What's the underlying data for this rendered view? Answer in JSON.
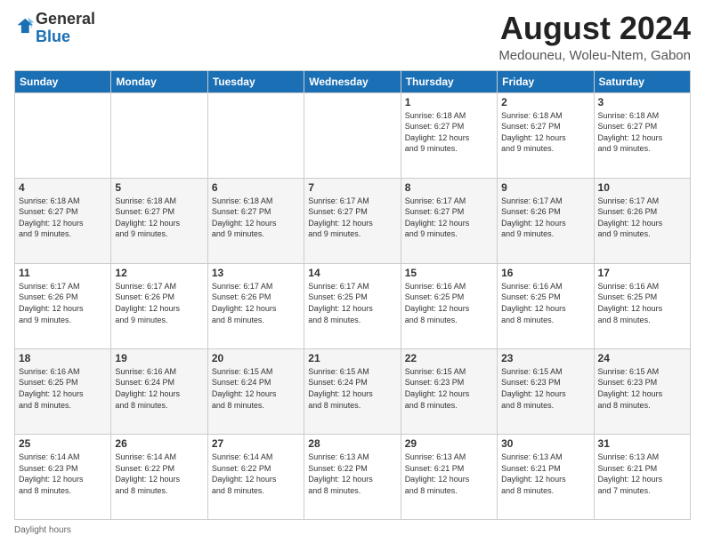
{
  "logo": {
    "general": "General",
    "blue": "Blue"
  },
  "title": "August 2024",
  "subtitle": "Medouneu, Woleu-Ntem, Gabon",
  "days_of_week": [
    "Sunday",
    "Monday",
    "Tuesday",
    "Wednesday",
    "Thursday",
    "Friday",
    "Saturday"
  ],
  "footer": "Daylight hours",
  "weeks": [
    [
      {
        "day": "",
        "info": ""
      },
      {
        "day": "",
        "info": ""
      },
      {
        "day": "",
        "info": ""
      },
      {
        "day": "",
        "info": ""
      },
      {
        "day": "1",
        "info": "Sunrise: 6:18 AM\nSunset: 6:27 PM\nDaylight: 12 hours\nand 9 minutes."
      },
      {
        "day": "2",
        "info": "Sunrise: 6:18 AM\nSunset: 6:27 PM\nDaylight: 12 hours\nand 9 minutes."
      },
      {
        "day": "3",
        "info": "Sunrise: 6:18 AM\nSunset: 6:27 PM\nDaylight: 12 hours\nand 9 minutes."
      }
    ],
    [
      {
        "day": "4",
        "info": "Sunrise: 6:18 AM\nSunset: 6:27 PM\nDaylight: 12 hours\nand 9 minutes."
      },
      {
        "day": "5",
        "info": "Sunrise: 6:18 AM\nSunset: 6:27 PM\nDaylight: 12 hours\nand 9 minutes."
      },
      {
        "day": "6",
        "info": "Sunrise: 6:18 AM\nSunset: 6:27 PM\nDaylight: 12 hours\nand 9 minutes."
      },
      {
        "day": "7",
        "info": "Sunrise: 6:17 AM\nSunset: 6:27 PM\nDaylight: 12 hours\nand 9 minutes."
      },
      {
        "day": "8",
        "info": "Sunrise: 6:17 AM\nSunset: 6:27 PM\nDaylight: 12 hours\nand 9 minutes."
      },
      {
        "day": "9",
        "info": "Sunrise: 6:17 AM\nSunset: 6:26 PM\nDaylight: 12 hours\nand 9 minutes."
      },
      {
        "day": "10",
        "info": "Sunrise: 6:17 AM\nSunset: 6:26 PM\nDaylight: 12 hours\nand 9 minutes."
      }
    ],
    [
      {
        "day": "11",
        "info": "Sunrise: 6:17 AM\nSunset: 6:26 PM\nDaylight: 12 hours\nand 9 minutes."
      },
      {
        "day": "12",
        "info": "Sunrise: 6:17 AM\nSunset: 6:26 PM\nDaylight: 12 hours\nand 9 minutes."
      },
      {
        "day": "13",
        "info": "Sunrise: 6:17 AM\nSunset: 6:26 PM\nDaylight: 12 hours\nand 8 minutes."
      },
      {
        "day": "14",
        "info": "Sunrise: 6:17 AM\nSunset: 6:25 PM\nDaylight: 12 hours\nand 8 minutes."
      },
      {
        "day": "15",
        "info": "Sunrise: 6:16 AM\nSunset: 6:25 PM\nDaylight: 12 hours\nand 8 minutes."
      },
      {
        "day": "16",
        "info": "Sunrise: 6:16 AM\nSunset: 6:25 PM\nDaylight: 12 hours\nand 8 minutes."
      },
      {
        "day": "17",
        "info": "Sunrise: 6:16 AM\nSunset: 6:25 PM\nDaylight: 12 hours\nand 8 minutes."
      }
    ],
    [
      {
        "day": "18",
        "info": "Sunrise: 6:16 AM\nSunset: 6:25 PM\nDaylight: 12 hours\nand 8 minutes."
      },
      {
        "day": "19",
        "info": "Sunrise: 6:16 AM\nSunset: 6:24 PM\nDaylight: 12 hours\nand 8 minutes."
      },
      {
        "day": "20",
        "info": "Sunrise: 6:15 AM\nSunset: 6:24 PM\nDaylight: 12 hours\nand 8 minutes."
      },
      {
        "day": "21",
        "info": "Sunrise: 6:15 AM\nSunset: 6:24 PM\nDaylight: 12 hours\nand 8 minutes."
      },
      {
        "day": "22",
        "info": "Sunrise: 6:15 AM\nSunset: 6:23 PM\nDaylight: 12 hours\nand 8 minutes."
      },
      {
        "day": "23",
        "info": "Sunrise: 6:15 AM\nSunset: 6:23 PM\nDaylight: 12 hours\nand 8 minutes."
      },
      {
        "day": "24",
        "info": "Sunrise: 6:15 AM\nSunset: 6:23 PM\nDaylight: 12 hours\nand 8 minutes."
      }
    ],
    [
      {
        "day": "25",
        "info": "Sunrise: 6:14 AM\nSunset: 6:23 PM\nDaylight: 12 hours\nand 8 minutes."
      },
      {
        "day": "26",
        "info": "Sunrise: 6:14 AM\nSunset: 6:22 PM\nDaylight: 12 hours\nand 8 minutes."
      },
      {
        "day": "27",
        "info": "Sunrise: 6:14 AM\nSunset: 6:22 PM\nDaylight: 12 hours\nand 8 minutes."
      },
      {
        "day": "28",
        "info": "Sunrise: 6:13 AM\nSunset: 6:22 PM\nDaylight: 12 hours\nand 8 minutes."
      },
      {
        "day": "29",
        "info": "Sunrise: 6:13 AM\nSunset: 6:21 PM\nDaylight: 12 hours\nand 8 minutes."
      },
      {
        "day": "30",
        "info": "Sunrise: 6:13 AM\nSunset: 6:21 PM\nDaylight: 12 hours\nand 8 minutes."
      },
      {
        "day": "31",
        "info": "Sunrise: 6:13 AM\nSunset: 6:21 PM\nDaylight: 12 hours\nand 7 minutes."
      }
    ]
  ]
}
